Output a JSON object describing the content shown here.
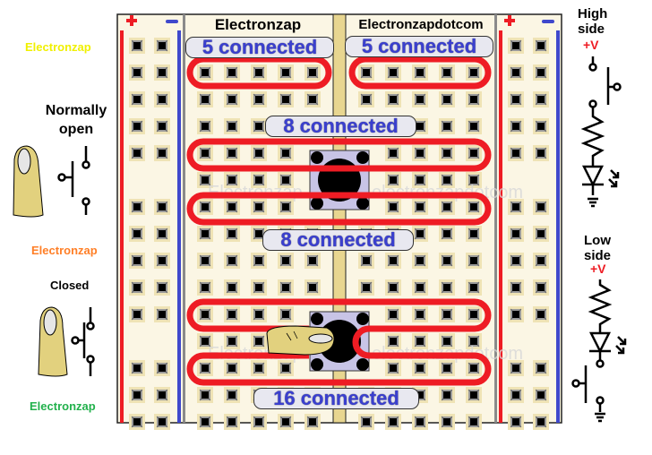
{
  "left_panel": {
    "watermark_top": "Electronzap",
    "normally_open_title": "Normally open",
    "watermark_mid": "Electronzap",
    "closed_title": "Closed",
    "watermark_bottom": "Electronzap"
  },
  "board": {
    "header_left": "Electronzap",
    "header_right": "Electronzapdotcom",
    "rail_plus_symbol": "+",
    "rail_minus_symbol": "−",
    "labels": {
      "top_left": "5 connected",
      "top_right": "5 connected",
      "middle_top": "8 connected",
      "middle_bottom": "8 connected",
      "bottom": "16 connected"
    },
    "watermark_left": "Electronzap",
    "watermark_right": "electronzapdotcom"
  },
  "right_panel": {
    "high_side_title": "High side",
    "high_side_voltage": "+V",
    "low_side_title": "Low side",
    "low_side_voltage": "+V"
  },
  "colors": {
    "rail_red": "#ee1c24",
    "rail_blue": "#3f48cc",
    "loop_red": "#ee1c24",
    "label_blue": "#3a3fcf",
    "board_cream": "#fbf6e4",
    "hole_pad": "#efe3b5",
    "button_body": "#c8c4e6",
    "watermark_yellow": "#f0f000",
    "watermark_orange": "#ff7f27",
    "watermark_green": "#22b14c",
    "voltage_red": "#ee1c24"
  }
}
